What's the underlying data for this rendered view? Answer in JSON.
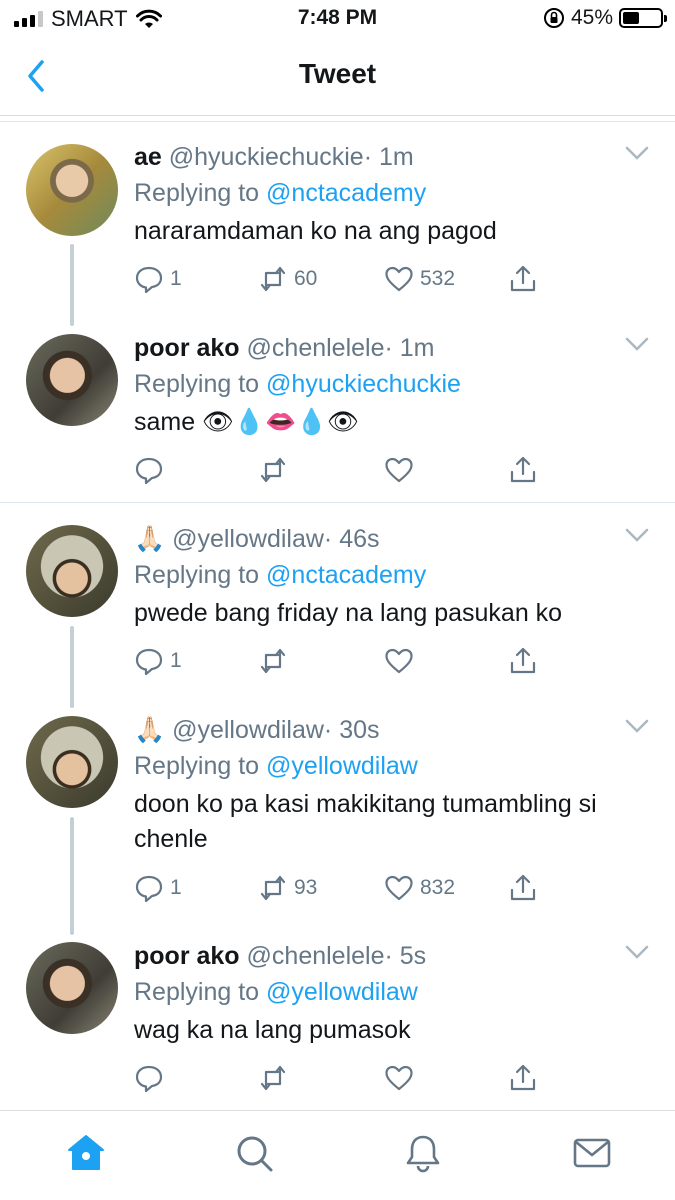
{
  "status_bar": {
    "carrier": "SMART",
    "time": "7:48 PM",
    "battery": "45%",
    "battery_level": 0.45,
    "icons": [
      "signal-icon",
      "wifi-icon",
      "orientation-lock-icon",
      "battery-icon"
    ]
  },
  "nav": {
    "title": "Tweet",
    "back_icon": "chevron-left-icon",
    "accent": "#1da1f2"
  },
  "tweets": [
    {
      "name": "ae",
      "handle": "@hyuckiechuckie",
      "time": "· 1m",
      "replying_label": "Replying to",
      "replying_to": "@nctacademy",
      "text": "nararamdaman ko na ang pagod",
      "replies": "1",
      "retweets": "60",
      "likes": "532"
    },
    {
      "name": "poor ako",
      "handle": "@chenlelele",
      "time": "· 1m",
      "replying_label": "Replying to",
      "replying_to": "@hyuckiechuckie",
      "text": "same 👁💧👄💧👁",
      "replies": "",
      "retweets": "",
      "likes": ""
    },
    {
      "name": "🙏🏻",
      "handle": "@yellowdilaw",
      "time": "· 46s",
      "replying_label": "Replying to",
      "replying_to": "@nctacademy",
      "text": "pwede bang friday na lang pasukan ko",
      "replies": "1",
      "retweets": "",
      "likes": ""
    },
    {
      "name": "🙏🏻",
      "handle": "@yellowdilaw",
      "time": "· 30s",
      "replying_label": "Replying to",
      "replying_to": "@yellowdilaw",
      "text": "doon ko pa kasi makikitang tumambling si chenle",
      "replies": "1",
      "retweets": "93",
      "likes": "832"
    },
    {
      "name": "poor ako",
      "handle": "@chenlelele",
      "time": "· 5s",
      "replying_label": "Replying to",
      "replying_to": "@yellowdilaw",
      "text": "wag ka na lang pumasok",
      "replies": "",
      "retweets": "",
      "likes": ""
    }
  ],
  "tab_bar": {
    "items": [
      "home-icon",
      "search-icon",
      "notifications-icon",
      "messages-icon"
    ],
    "active": "home-icon"
  }
}
